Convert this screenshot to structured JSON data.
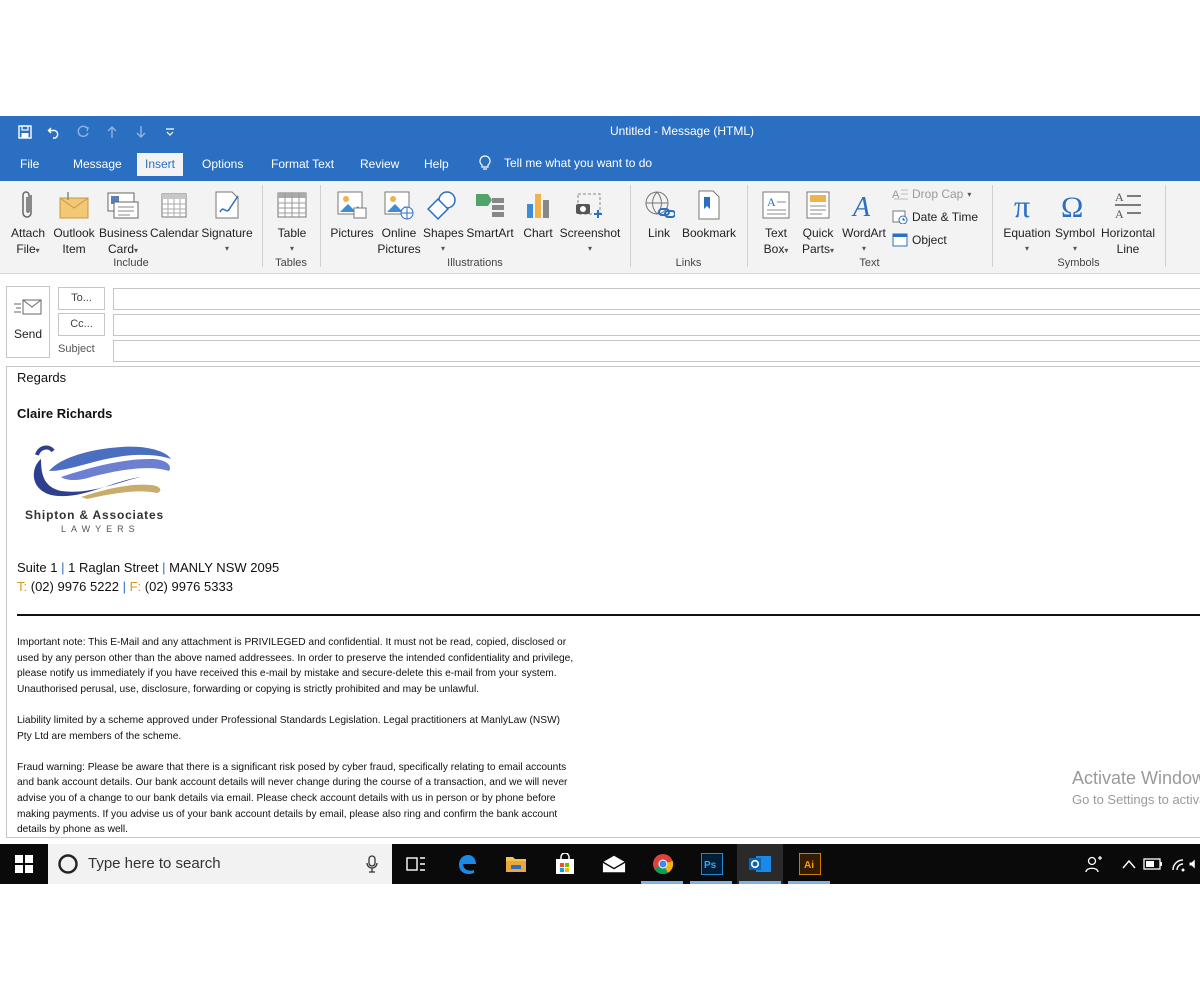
{
  "window": {
    "title": "Untitled  -  Message (HTML)"
  },
  "tabs": [
    {
      "label": "File"
    },
    {
      "label": "Message"
    },
    {
      "label": "Insert",
      "active": true
    },
    {
      "label": "Options"
    },
    {
      "label": "Format Text"
    },
    {
      "label": "Review"
    },
    {
      "label": "Help"
    }
  ],
  "tell_me": "Tell me what you want to do",
  "ribbon": {
    "include": {
      "group": "Include",
      "attach_file": [
        "Attach",
        "File"
      ],
      "outlook_item": [
        "Outlook",
        "Item"
      ],
      "business_card": [
        "Business",
        "Card"
      ],
      "calendar": "Calendar",
      "signature": "Signature"
    },
    "tables": {
      "group": "Tables",
      "table": "Table"
    },
    "illustrations": {
      "group": "Illustrations",
      "pictures": "Pictures",
      "online_pictures": [
        "Online",
        "Pictures"
      ],
      "shapes": "Shapes",
      "smartart": "SmartArt",
      "chart": "Chart",
      "screenshot": "Screenshot"
    },
    "links": {
      "group": "Links",
      "link": "Link",
      "bookmark": "Bookmark"
    },
    "text": {
      "group": "Text",
      "text_box": [
        "Text",
        "Box"
      ],
      "quick_parts": [
        "Quick",
        "Parts"
      ],
      "wordart": "WordArt",
      "drop_cap": "Drop Cap",
      "date_time": "Date & Time",
      "object": "Object"
    },
    "symbols": {
      "group": "Symbols",
      "equation": "Equation",
      "symbol": "Symbol",
      "horizontal_line": [
        "Horizontal",
        "Line"
      ]
    }
  },
  "compose": {
    "send": "Send",
    "to": "To...",
    "cc": "Cc...",
    "subject_label": "Subject",
    "to_value": "",
    "cc_value": "",
    "subject_value": ""
  },
  "body": {
    "regards": "Regards",
    "name": "Claire Richards",
    "logo": {
      "name": "Shipton & Associates",
      "tagline": "LAWYERS"
    },
    "address": {
      "suite": "Suite 1",
      "street": "1 Raglan Street",
      "city": "MANLY NSW 2095",
      "sep": "|"
    },
    "phone": {
      "t_label": "T:",
      "t_value": "(02) 9976 5222",
      "f_label": "F:",
      "f_value": "(02) 9976 5333",
      "sep": "|"
    },
    "disclaimer": [
      [
        "Important note: This E-Mail and any attachment is PRIVILEGED and confidential.  It must not be read, copied, disclosed or",
        "used by any person other than the above named addressees.  In order to preserve the intended confidentiality and privilege,",
        "please notify us immediately if you have received this e-mail by mistake and secure-delete this e-mail from your system.",
        "Unauthorised perusal, use, disclosure, forwarding or copying is strictly prohibited and may be unlawful."
      ],
      [
        "Liability limited by a scheme approved under Professional Standards Legislation. Legal practitioners at ManlyLaw (NSW)",
        "Pty Ltd are members of the scheme."
      ],
      [
        "Fraud warning: Please be aware that there is a significant risk posed by cyber fraud, specifically relating to email accounts",
        "and bank account details. Our bank account details will never change during the course of a transaction, and we will never",
        "advise you of a change to our bank details via email.  Please check account details with us in person or by phone before",
        "making payments.  If you advise us of your bank account details by email, please also ring and confirm the bank account",
        "details by phone as well."
      ]
    ]
  },
  "activate": {
    "line1": "Activate Windows",
    "line2": "Go to Settings to activate Windows."
  },
  "taskbar": {
    "search_placeholder": "Type here to search"
  },
  "colors": {
    "accent": "#2b6fc2",
    "orange_label": "#d39a1f",
    "separator_blue": "#2b6fc2"
  }
}
